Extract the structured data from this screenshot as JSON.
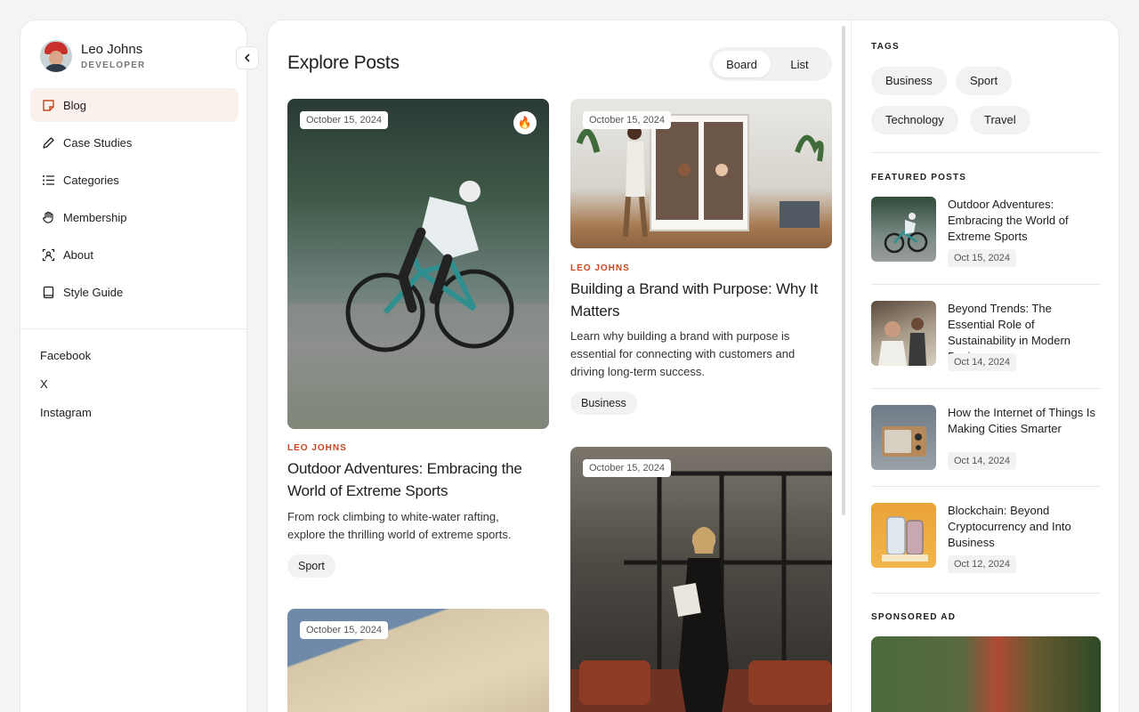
{
  "profile": {
    "name": "Leo Johns",
    "role": "DEVELOPER"
  },
  "nav": [
    {
      "label": "Blog",
      "icon": "blog-icon",
      "active": true
    },
    {
      "label": "Case Studies",
      "icon": "pencil-icon"
    },
    {
      "label": "Categories",
      "icon": "list-icon"
    },
    {
      "label": "Membership",
      "icon": "hand-icon"
    },
    {
      "label": "About",
      "icon": "user-frame-icon"
    },
    {
      "label": "Style Guide",
      "icon": "book-icon"
    }
  ],
  "social": [
    "Facebook",
    "X",
    "Instagram"
  ],
  "main": {
    "title": "Explore Posts",
    "view_options": [
      "Board",
      "List"
    ],
    "selected_view": "Board"
  },
  "posts": [
    {
      "date": "October 15, 2024",
      "author": "LEO JOHNS",
      "title": "Outdoor Adventures: Embracing the World of Extreme Sports",
      "description": "From rock climbing to white-water rafting, explore the thrilling world of extreme sports.",
      "tag": "Sport",
      "featured_icon": "fire-icon"
    },
    {
      "date": "October 15, 2024",
      "author": "LEO JOHNS",
      "title": "Building a Brand with Purpose: Why It Matters",
      "description": "Learn why building a brand with purpose is essential for connecting with customers and driving long-term success.",
      "tag": "Business"
    },
    {
      "date": "October 15, 2024"
    },
    {
      "date": "October 15, 2024"
    }
  ],
  "sidebar_right": {
    "tags_heading": "TAGS",
    "tags": [
      "Business",
      "Sport",
      "Technology",
      "Travel"
    ],
    "featured_heading": "FEATURED POSTS",
    "featured": [
      {
        "title": "Outdoor Adventures: Embracing the World of Extreme Sports",
        "date": "Oct 15, 2024"
      },
      {
        "title": "Beyond Trends: The Essential Role of Sustainability in Modern Busines",
        "date": "Oct 14, 2024"
      },
      {
        "title": "How the Internet of Things Is Making Cities Smarter",
        "date": "Oct 14, 2024"
      },
      {
        "title": "Blockchain: Beyond Cryptocurrency and Into Business",
        "date": "Oct 12, 2024"
      }
    ],
    "ad_heading": "SPONSORED AD"
  },
  "colors": {
    "accent": "#c9461f",
    "active_nav_bg": "#fbf1ec",
    "background": "#f4f4f3"
  }
}
